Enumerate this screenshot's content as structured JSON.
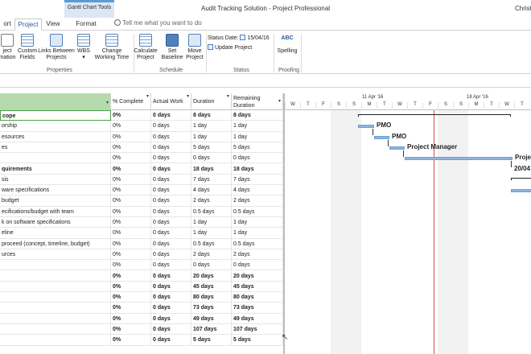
{
  "titlebar": {
    "contextual_tab": "Gantt Chart Tools",
    "app_title": "Audit Tracking Solution - Project Professional",
    "user": "Christ"
  },
  "tabs": [
    {
      "label": "ort"
    },
    {
      "label": "Project",
      "active": true
    },
    {
      "label": "View"
    },
    {
      "label": "Format"
    }
  ],
  "tell_me": "Tell me what you want to do",
  "ribbon": {
    "buttons": {
      "project_info": "ject\nmation",
      "custom_fields": "Custom\nFields",
      "links": "Links Between\nProjects",
      "wbs": "WBS",
      "change_time": "Change\nWorking Time",
      "calculate": "Calculate\nProject",
      "set_baseline": "Set\nBaseline",
      "move_project": "Move\nProject",
      "spelling": "Spelling"
    },
    "status_date_label": "Status Date:",
    "status_date_value": "15/04/16",
    "update_project": "Update Project",
    "groups": {
      "properties": "Properties",
      "schedule": "Schedule",
      "status": "Status",
      "proofing": "Proofing"
    },
    "spelling_icon_text": "ABC"
  },
  "columns": {
    "pct_complete": "% Complete",
    "actual_work": "Actual Work",
    "duration": "Duration",
    "remaining_duration": "Remaining Duration"
  },
  "rows": [
    {
      "name": "cope",
      "pct": "0%",
      "actual": "0 days",
      "duration": "8 days",
      "remaining": "8 days",
      "bold": true,
      "selected": true
    },
    {
      "name": "orship",
      "pct": "0%",
      "actual": "0 days",
      "duration": "1 day",
      "remaining": "1 day"
    },
    {
      "name": "esources",
      "pct": "0%",
      "actual": "0 days",
      "duration": "1 day",
      "remaining": "1 day"
    },
    {
      "name": "es",
      "pct": "0%",
      "actual": "0 days",
      "duration": "5 days",
      "remaining": "5 days"
    },
    {
      "name": "",
      "pct": "0%",
      "actual": "0 days",
      "duration": "0 days",
      "remaining": "0 days"
    },
    {
      "name": "quirements",
      "pct": "0%",
      "actual": "0 days",
      "duration": "18 days",
      "remaining": "18 days",
      "bold": true
    },
    {
      "name": "sis",
      "pct": "0%",
      "actual": "0 days",
      "duration": "7 days",
      "remaining": "7 days"
    },
    {
      "name": "ware specifications",
      "pct": "0%",
      "actual": "0 days",
      "duration": "4 days",
      "remaining": "4 days"
    },
    {
      "name": "budget",
      "pct": "0%",
      "actual": "0 days",
      "duration": "2 days",
      "remaining": "2 days"
    },
    {
      "name": "ecifications/budget with team",
      "pct": "0%",
      "actual": "0 days",
      "duration": "0.5 days",
      "remaining": "0.5 days"
    },
    {
      "name": "k on software specifications",
      "pct": "0%",
      "actual": "0 days",
      "duration": "1 day",
      "remaining": "1 day"
    },
    {
      "name": "eline",
      "pct": "0%",
      "actual": "0 days",
      "duration": "1 day",
      "remaining": "1 day"
    },
    {
      "name": "proceed (concept, timeline, budget)",
      "pct": "0%",
      "actual": "0 days",
      "duration": "0.5 days",
      "remaining": "0.5 days"
    },
    {
      "name": "urces",
      "pct": "0%",
      "actual": "0 days",
      "duration": "2 days",
      "remaining": "2 days"
    },
    {
      "name": "",
      "pct": "0%",
      "actual": "0 days",
      "duration": "0 days",
      "remaining": "0 days"
    },
    {
      "name": "",
      "pct": "0%",
      "actual": "0 days",
      "duration": "20 days",
      "remaining": "20 days",
      "bold": true
    },
    {
      "name": "",
      "pct": "0%",
      "actual": "0 days",
      "duration": "45 days",
      "remaining": "45 days",
      "bold": true
    },
    {
      "name": "",
      "pct": "0%",
      "actual": "0 days",
      "duration": "80 days",
      "remaining": "80 days",
      "bold": true
    },
    {
      "name": "",
      "pct": "0%",
      "actual": "0 days",
      "duration": "73 days",
      "remaining": "73 days",
      "bold": true
    },
    {
      "name": "",
      "pct": "0%",
      "actual": "0 days",
      "duration": "49 days",
      "remaining": "49 days",
      "bold": true
    },
    {
      "name": "",
      "pct": "0%",
      "actual": "0 days",
      "duration": "107 days",
      "remaining": "107 days",
      "bold": true
    },
    {
      "name": "",
      "pct": "0%",
      "actual": "0 days",
      "duration": "5 days",
      "remaining": "5 days",
      "bold": true
    }
  ],
  "gantt": {
    "weeks": [
      "11 Apr '16",
      "18 Apr '16"
    ],
    "days": [
      "W",
      "T",
      "F",
      "S",
      "S",
      "M",
      "T",
      "W",
      "T",
      "F",
      "S",
      "S",
      "M",
      "T",
      "W",
      "T"
    ],
    "labels": [
      "PMO",
      "PMO",
      "Project Manager",
      "Projec",
      "20/04"
    ]
  },
  "colors": {
    "name_header": "#b5dbad",
    "bar": "#8eb4e3",
    "today_line": "#d05050",
    "contextual_tab": "#dce6f4"
  }
}
